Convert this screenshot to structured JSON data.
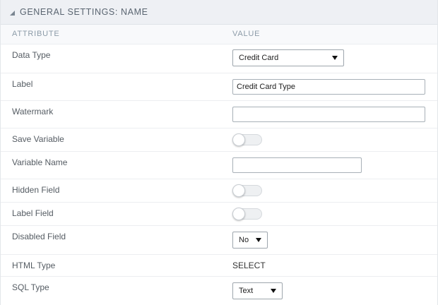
{
  "header": {
    "title": "GENERAL SETTINGS: NAME"
  },
  "columns": {
    "attribute": "ATTRIBUTE",
    "value": "VALUE"
  },
  "rows": {
    "data_type": {
      "label": "Data Type",
      "selected": "Credit Card"
    },
    "label": {
      "label": "Label",
      "value": "Credit Card Type"
    },
    "watermark": {
      "label": "Watermark",
      "value": ""
    },
    "save_variable": {
      "label": "Save Variable",
      "enabled": false
    },
    "variable_name": {
      "label": "Variable Name",
      "value": ""
    },
    "hidden_field": {
      "label": "Hidden Field",
      "enabled": false
    },
    "label_field": {
      "label": "Label Field",
      "enabled": false
    },
    "disabled_field": {
      "label": "Disabled Field",
      "selected": "No"
    },
    "html_type": {
      "label": "HTML Type",
      "value": "SELECT"
    },
    "sql_type": {
      "label": "SQL Type",
      "selected": "Text"
    }
  }
}
